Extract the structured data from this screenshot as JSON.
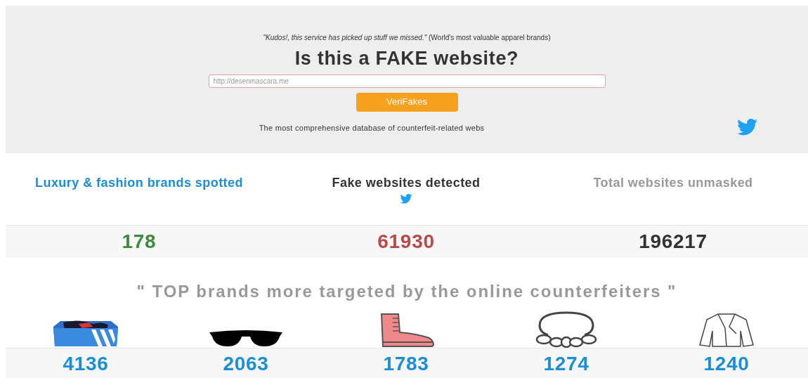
{
  "hero": {
    "quote": "*\"Kudos!, this service has picked up stuff we missed.\"* (World's most valuable apparel brands)",
    "title": "Is this a FAKE website?",
    "search": {
      "placeholder": "http://desenmascara.me"
    },
    "button": "VeriFakes",
    "tagline": "The most comprehensive database of counterfeit-related webs"
  },
  "stats": [
    {
      "kind": "brands",
      "label": "Luxury & fashion brands spotted",
      "value": "178"
    },
    {
      "kind": "fake",
      "label": "Fake websites detected",
      "value": "61930"
    },
    {
      "kind": "total",
      "label": "Total websites unmasked",
      "value": "196217"
    }
  ],
  "top_brands": {
    "title": "\" TOP brands more targeted by the online counterfeiters \"",
    "items": [
      {
        "kind": "shoebox",
        "count": "4136"
      },
      {
        "kind": "sunglasses",
        "count": "2063"
      },
      {
        "kind": "boot",
        "count": "1783"
      },
      {
        "kind": "necklace",
        "count": "1274"
      },
      {
        "kind": "jacket",
        "count": "1240"
      }
    ]
  }
}
